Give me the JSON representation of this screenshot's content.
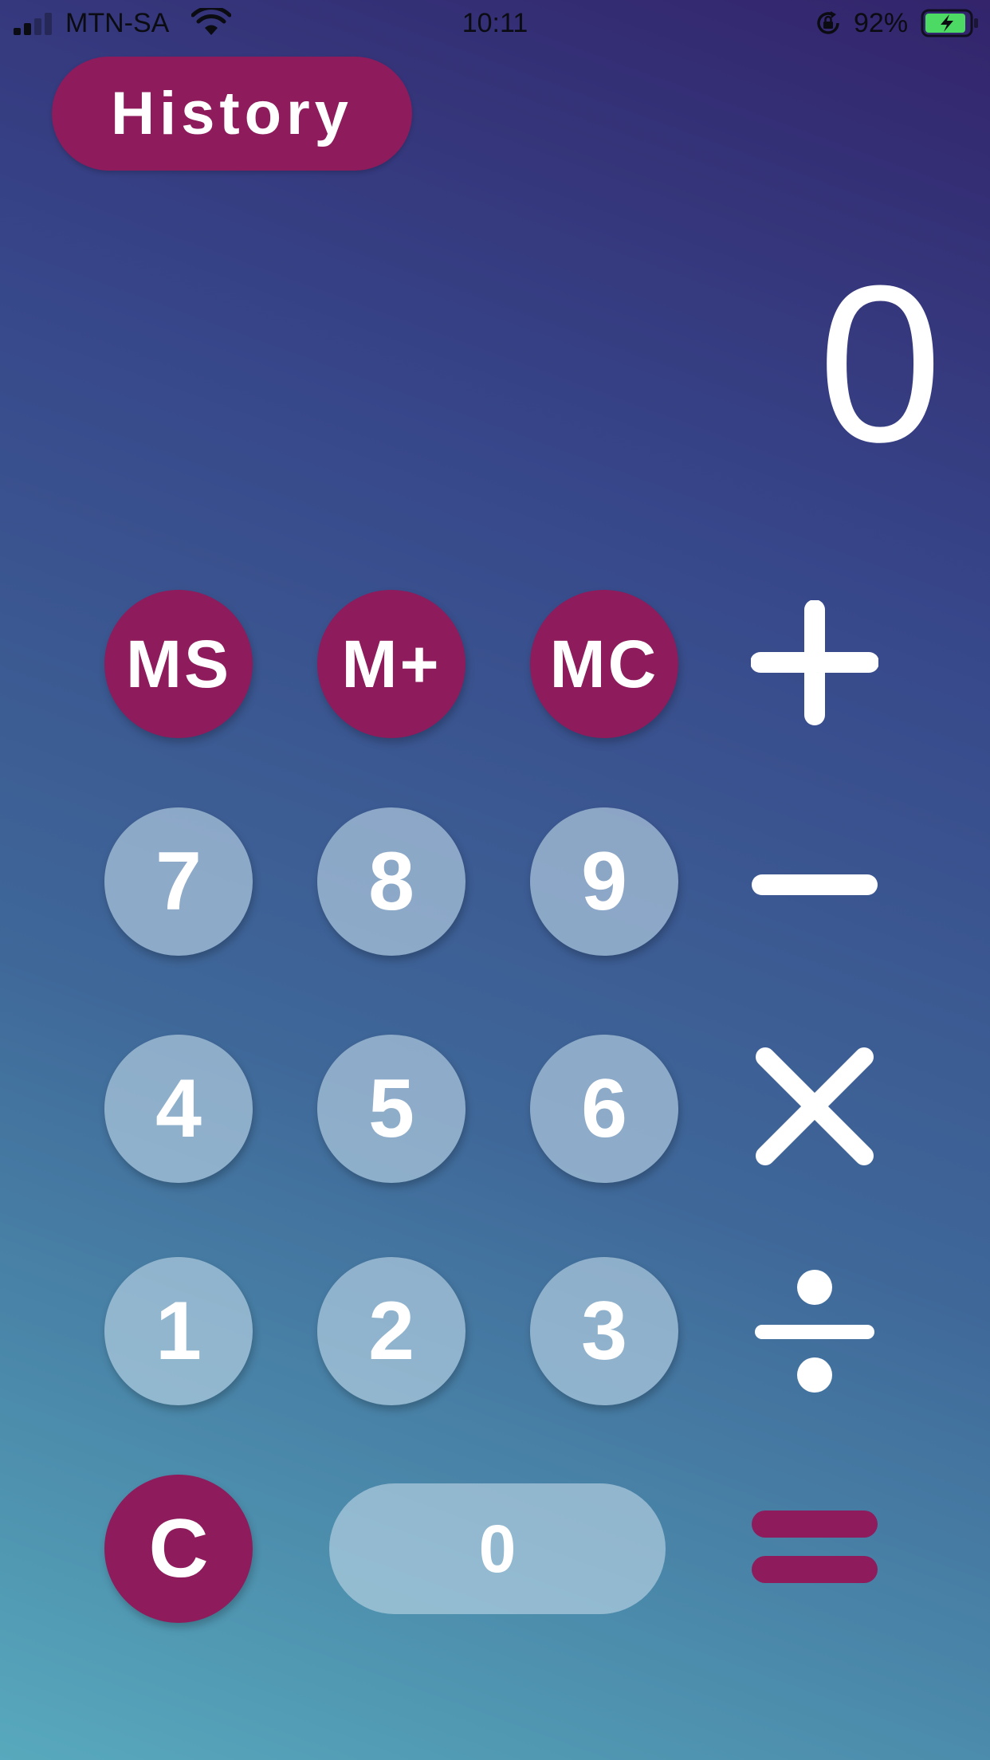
{
  "status_bar": {
    "carrier": "MTN-SA",
    "time": "10:11",
    "battery_percent": "92%",
    "battery_level": 0.92,
    "charging": true,
    "signal_bars_filled": 2,
    "signal_bars_total": 4,
    "icons": [
      "signal-icon",
      "wifi-icon",
      "orientation-lock-icon",
      "battery-icon"
    ]
  },
  "header": {
    "history_label": "History"
  },
  "display": {
    "value": "0"
  },
  "keypad": {
    "memory": {
      "ms": "MS",
      "m_plus": "M+",
      "mc": "MC"
    },
    "digits": {
      "d7": "7",
      "d8": "8",
      "d9": "9",
      "d4": "4",
      "d5": "5",
      "d6": "6",
      "d1": "1",
      "d2": "2",
      "d3": "3",
      "d0": "0"
    },
    "clear": "C",
    "operators": [
      "plus-icon",
      "minus-icon",
      "multiply-icon",
      "divide-icon",
      "equals-icon"
    ]
  },
  "colors": {
    "accent": "#8e1b5b",
    "key_light": "#bed7e6",
    "text": "#ffffff",
    "background_top": "#33246c",
    "background_bottom": "#58a9bd"
  }
}
